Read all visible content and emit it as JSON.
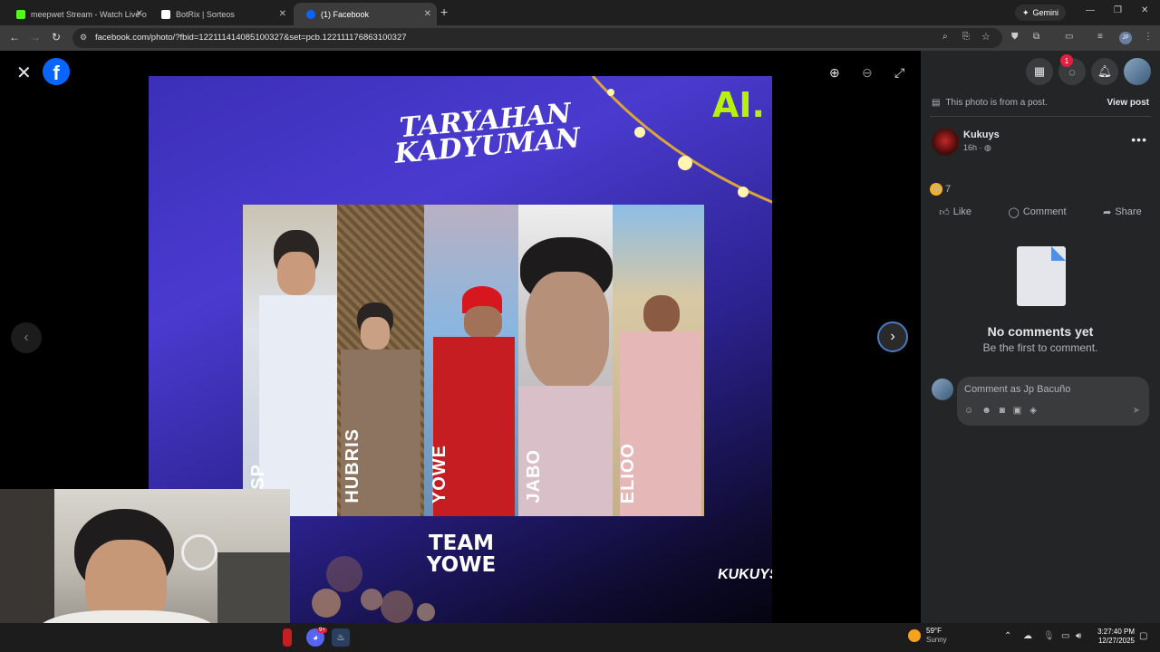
{
  "tabs": [
    {
      "title": "meepwet Stream - Watch Live o",
      "favicon_color": "#53fc18",
      "active": false
    },
    {
      "title": "BotRix | Sorteos",
      "favicon_color": "#ffffff",
      "active": false
    },
    {
      "title": "(1) Facebook",
      "favicon_color": "#0866ff",
      "active": true
    }
  ],
  "browser": {
    "new_tab": "+",
    "gemini_label": "Gemini",
    "url": "facebook.com/photo/?fbid=122111414085100327&set=pcb.122111176863100327",
    "profile_initials": "JP"
  },
  "viewer": {
    "photo": {
      "title_line1": "TARYAHAN",
      "title_line2": "KADYUMAN",
      "brand": "AI.",
      "team_line1": "TEAM",
      "team_line2": "YOWE",
      "footer_logo": "KUKUYS",
      "members": [
        "HSP",
        "HUBRIS",
        "YOWE",
        "JABO",
        "ELIOO"
      ]
    }
  },
  "side": {
    "messenger_badge": "1",
    "post_note": "This photo is from a post.",
    "view_post": "View post",
    "author": "Kukuys",
    "time": "16h ·",
    "reaction_count": "7",
    "actions": {
      "like": "Like",
      "comment": "Comment",
      "share": "Share"
    },
    "no_comments_title": "No comments yet",
    "no_comments_sub": "Be the first to comment.",
    "comment_placeholder": "Comment as Jp Bacuño"
  },
  "taskbar": {
    "discord_badge": "9+",
    "temp": "59°F",
    "condition": "Sunny",
    "time": "3:27:40 PM",
    "date": "12/27/2025"
  }
}
